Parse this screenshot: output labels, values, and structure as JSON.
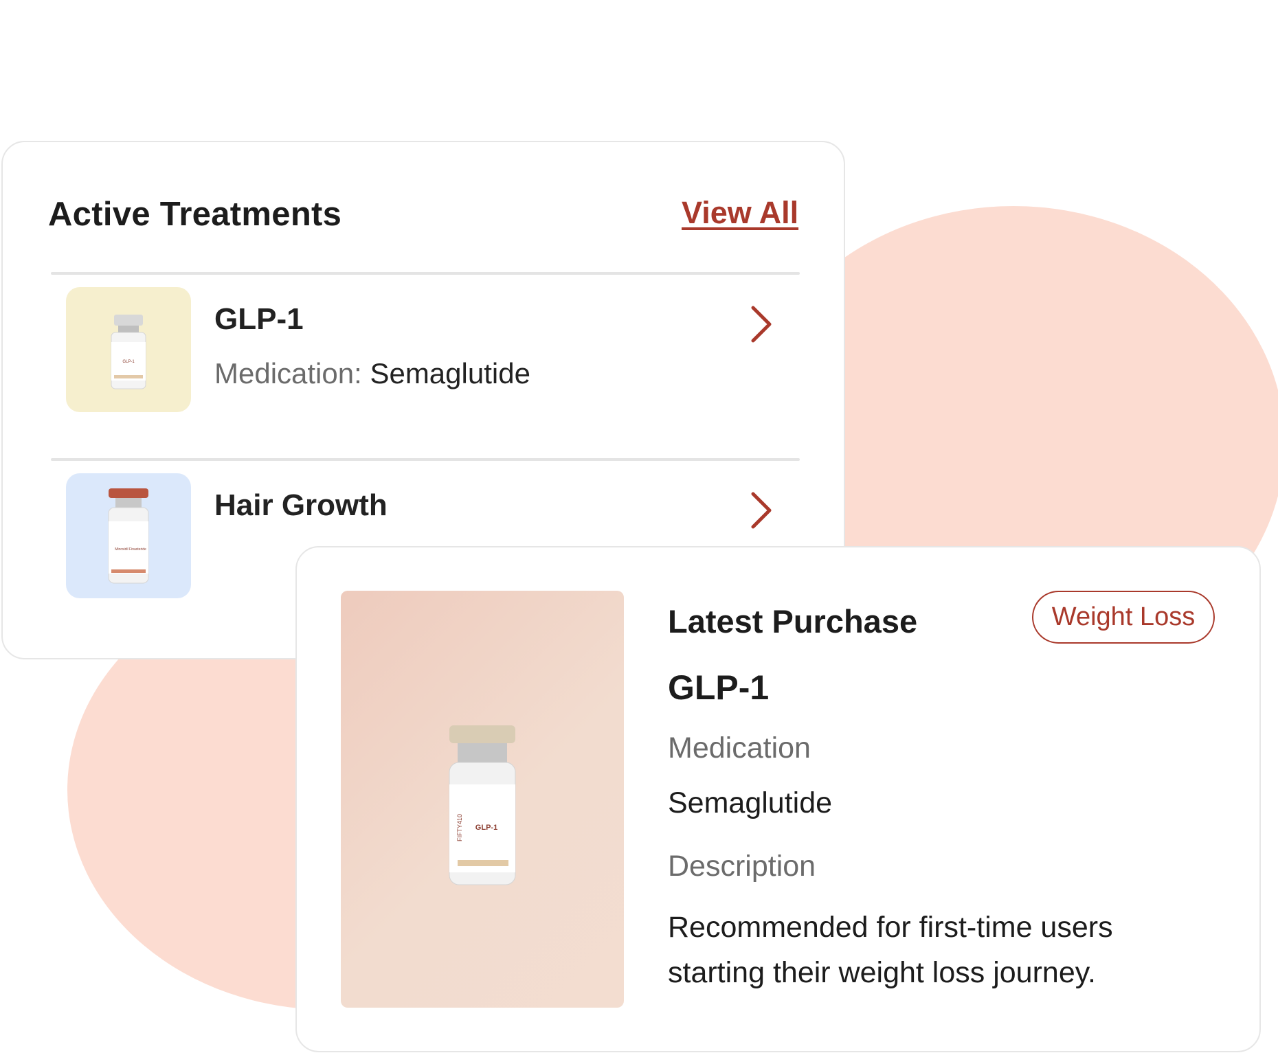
{
  "active_treatments": {
    "title": "Active Treatments",
    "view_all_label": "View All",
    "items": [
      {
        "name": "GLP-1",
        "medication_label": "Medication:",
        "medication_value": "Semaglutide",
        "vial_label": "GLP-1"
      },
      {
        "name": "Hair Growth",
        "vial_label": "Minoxidil Finasteride"
      }
    ]
  },
  "latest_purchase": {
    "title": "Latest Purchase",
    "badge": "Weight Loss",
    "product": "GLP-1",
    "medication_label": "Medication",
    "medication_value": "Semaglutide",
    "description_label": "Description",
    "description_value": "Recommended for first-time users starting their weight loss journey.",
    "vial_brand": "FIFTY410",
    "vial_label": "GLP-1"
  },
  "colors": {
    "accent": "#a9392b",
    "blob": "#fcdcd1",
    "thumb_yellow": "#f6efce",
    "thumb_blue": "#dbe8fb"
  }
}
